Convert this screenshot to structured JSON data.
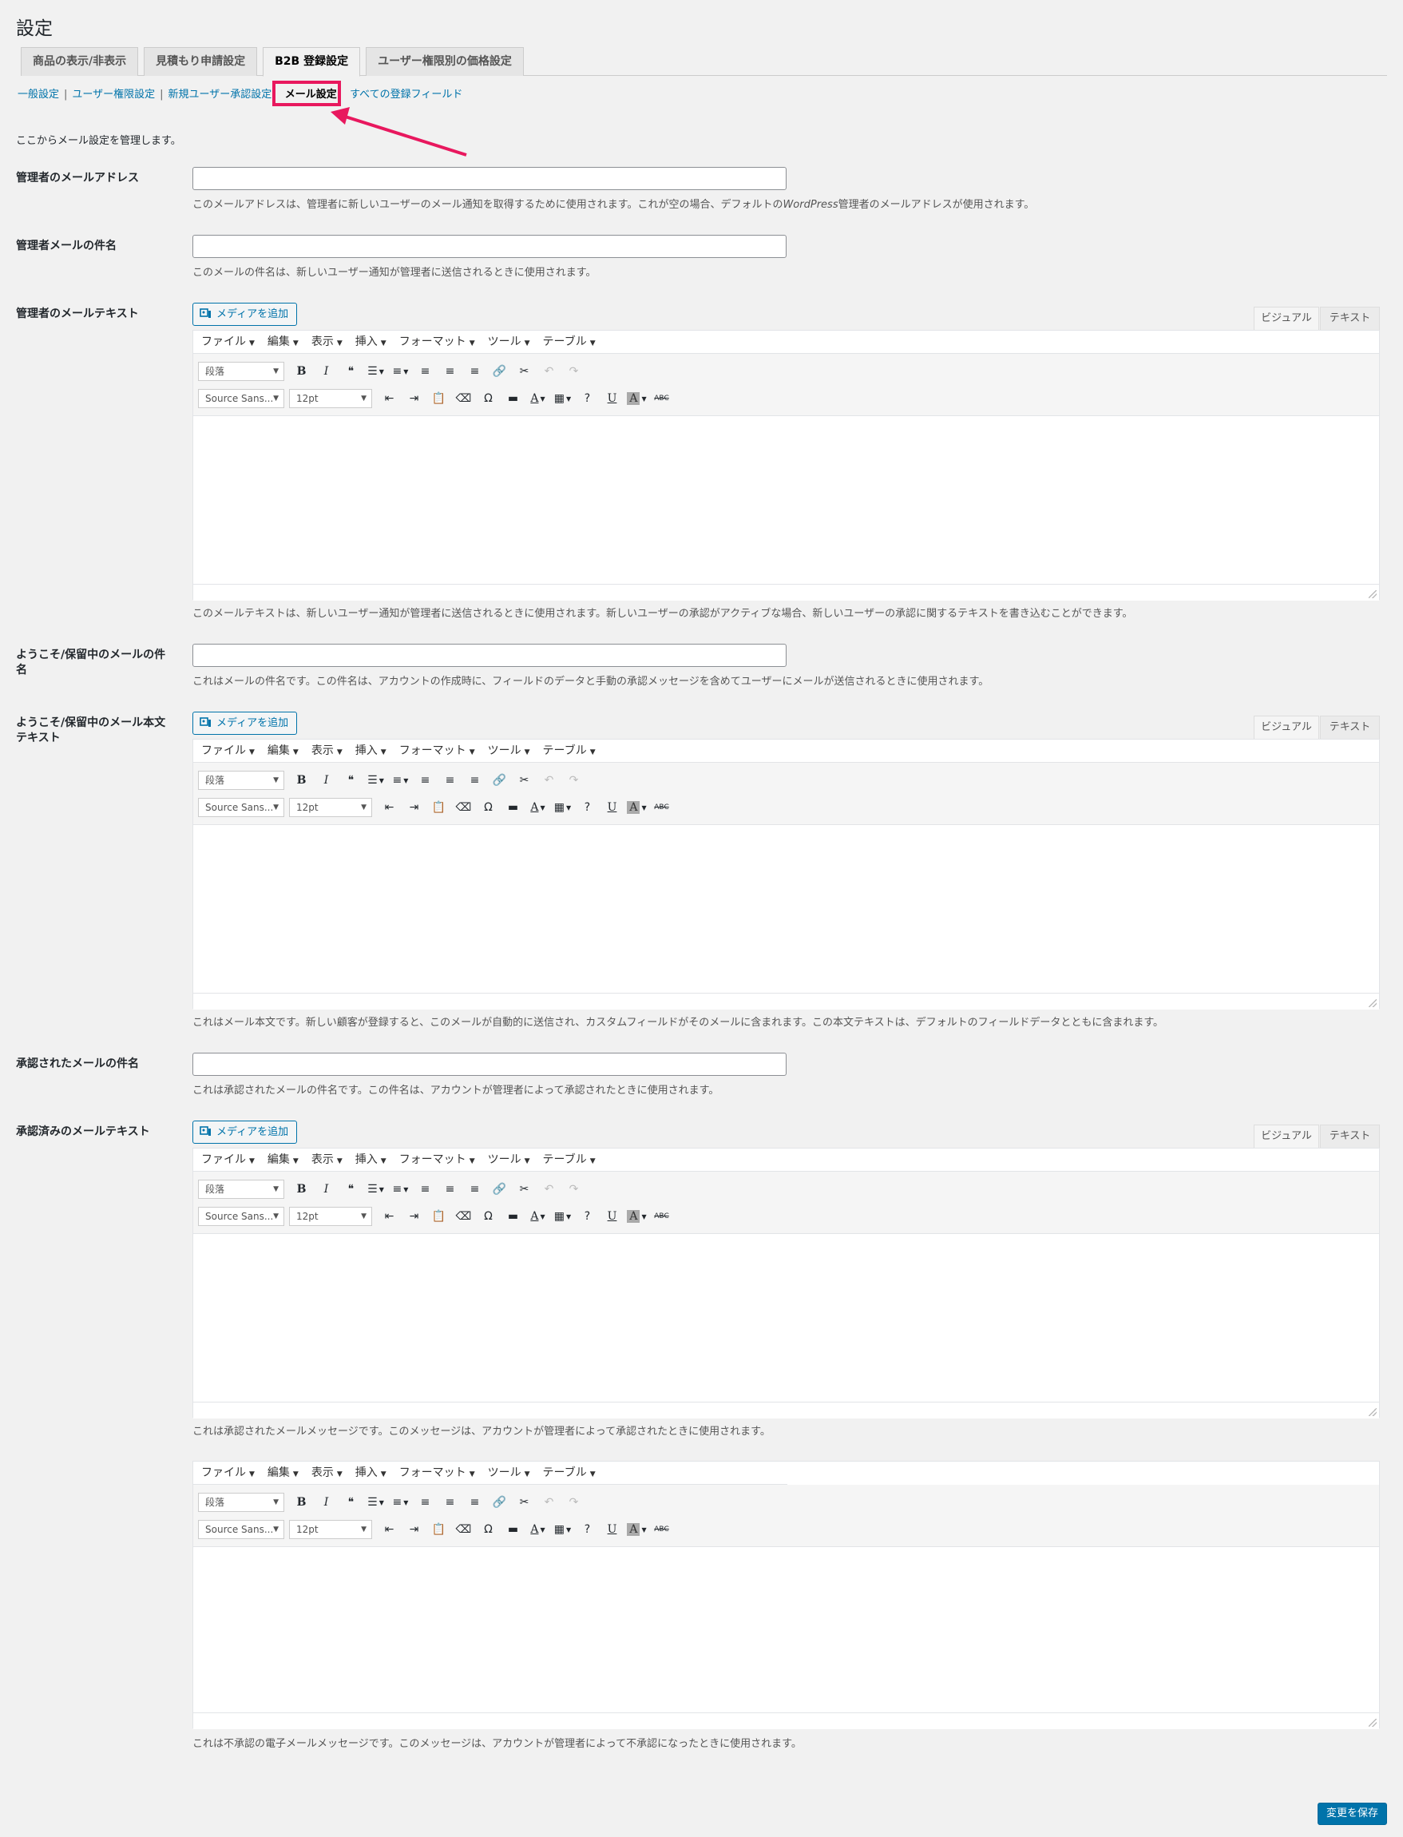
{
  "page": {
    "title": "設定"
  },
  "tabs": [
    {
      "label": "商品の表示/非表示"
    },
    {
      "label": "見積もり申請設定"
    },
    {
      "label": "B2B 登録設定"
    },
    {
      "label": "ユーザー権限別の価格設定"
    }
  ],
  "subnav": [
    {
      "label": "一般設定"
    },
    {
      "label": "ユーザー権限設定"
    },
    {
      "label": "新規ユーザー承認設定"
    },
    {
      "label": "メール設定"
    },
    {
      "label": "すべての登録フィールド"
    }
  ],
  "intro": "ここからメール設定を管理します。",
  "annotation": {
    "highlight_color": "#e8185e"
  },
  "editor_common": {
    "media_button": "メディアを追加",
    "visual_tab": "ビジュアル",
    "text_tab": "テキスト",
    "menus": [
      "ファイル",
      "編集",
      "表示",
      "挿入",
      "フォーマット",
      "ツール",
      "テーブル"
    ],
    "format_select": "段落",
    "font_select": "Source Sans...",
    "size_select": "12pt",
    "toolbar_icons_row1": [
      "bold-icon",
      "italic-icon",
      "blockquote-icon",
      "bullet-list-icon",
      "numbered-list-icon",
      "align-left-icon",
      "align-center-icon",
      "align-right-icon",
      "link-icon",
      "unlink-icon",
      "undo-icon",
      "redo-icon"
    ],
    "toolbar_icons_row2": [
      "outdent-icon",
      "indent-icon",
      "paste-text-icon",
      "clear-format-icon",
      "special-char-icon",
      "hr-icon",
      "text-color-icon",
      "table-icon",
      "help-icon",
      "underline-icon",
      "background-color-icon",
      "strikethrough-icon"
    ]
  },
  "fields": {
    "admin_email": {
      "label": "管理者のメールアドレス",
      "value": "",
      "desc_before": "このメールアドレスは、管理者に新しいユーザーのメール通知を取得するために使用されます。これが空の場合、デフォルトの",
      "desc_em": "WordPress",
      "desc_after": "管理者のメールアドレスが使用されます。"
    },
    "admin_subject": {
      "label": "管理者メールの件名",
      "value": "",
      "desc": "このメールの件名は、新しいユーザー通知が管理者に送信されるときに使用されます。"
    },
    "admin_text": {
      "label": "管理者のメールテキスト",
      "desc": "このメールテキストは、新しいユーザー通知が管理者に送信されるときに使用されます。新しいユーザーの承認がアクティブな場合、新しいユーザーの承認に関するテキストを書き込むことができます。"
    },
    "welcome_subject": {
      "label": "ようこそ/保留中のメールの件名",
      "value": "",
      "desc": "これはメールの件名です。この件名は、アカウントの作成時に、フィールドのデータと手動の承認メッセージを含めてユーザーにメールが送信されるときに使用されます。"
    },
    "welcome_body": {
      "label": "ようこそ/保留中のメール本文テキスト",
      "desc": "これはメール本文です。新しい顧客が登録すると、このメールが自動的に送信され、カスタムフィールドがそのメールに含まれます。この本文テキストは、デフォルトのフィールドデータとともに含まれます。"
    },
    "approved_subject": {
      "label": "承認されたメールの件名",
      "value": "",
      "desc": "これは承認されたメールの件名です。この件名は、アカウントが管理者によって承認されたときに使用されます。"
    },
    "approved_text": {
      "label": "承認済みのメールテキスト",
      "desc": "これは承認されたメールメッセージです。このメッセージは、アカウントが管理者によって承認されたときに使用されます。"
    },
    "disapproved_text": {
      "desc": "これは不承認の電子メールメッセージです。このメッセージは、アカウントが管理者によって不承認になったときに使用されます。"
    }
  },
  "save_button": "変更を保存"
}
